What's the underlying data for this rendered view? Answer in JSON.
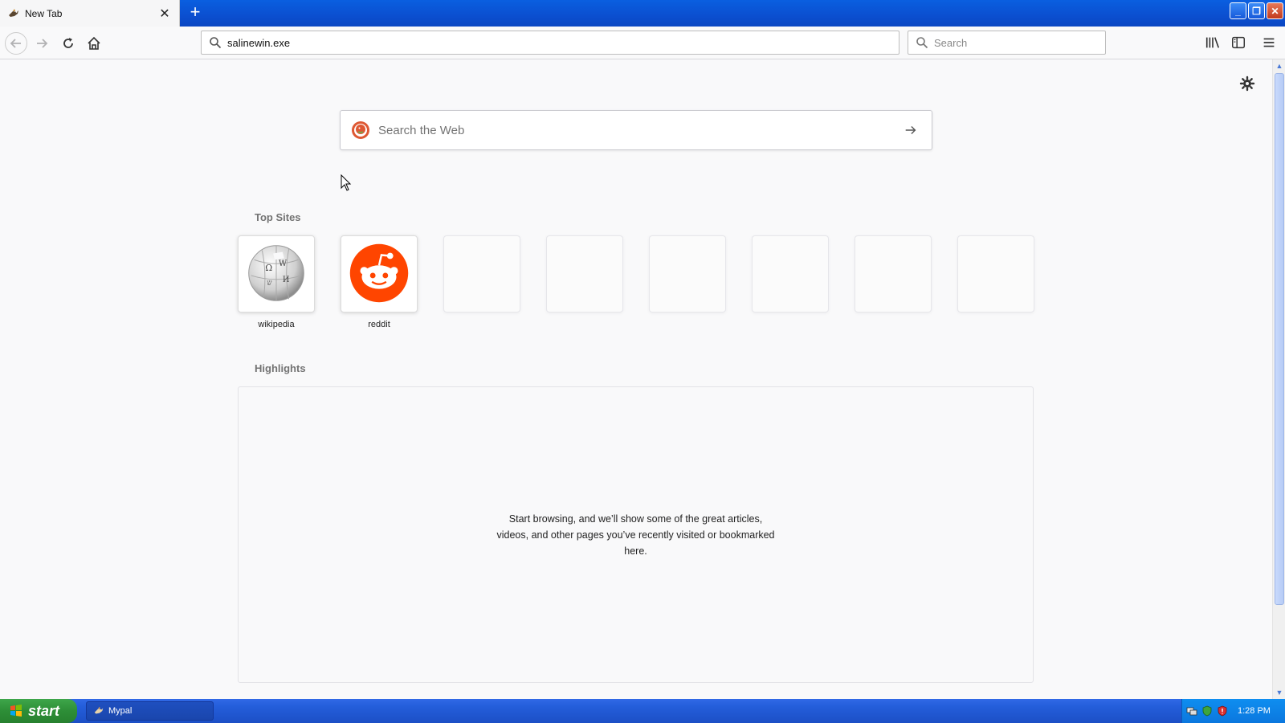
{
  "browser": {
    "tab": {
      "title": "New Tab",
      "close_glyph": "✕",
      "icon": "bird-browser-icon"
    },
    "new_tab_glyph": "+",
    "window_controls": {
      "minimize": "_",
      "maximize": "❐",
      "close": "✕"
    },
    "url": "salinewin.exe",
    "search_placeholder": "Search"
  },
  "newtab": {
    "web_search_placeholder": "Search the Web",
    "top_sites_title": "Top Sites",
    "top_sites": [
      {
        "label": "wikipedia"
      },
      {
        "label": "reddit"
      }
    ],
    "highlights_title": "Highlights",
    "highlights_empty": "Start browsing, and we’ll show some of the great articles, videos, and other pages you’ve recently visited or bookmarked here."
  },
  "taskbar": {
    "start_label": "start",
    "task_label": "Mypal",
    "clock": "1:28 PM"
  },
  "colors": {
    "reddit": "#ff4500",
    "xp_blue": "#245edb",
    "start_green": "#2d8e37"
  }
}
